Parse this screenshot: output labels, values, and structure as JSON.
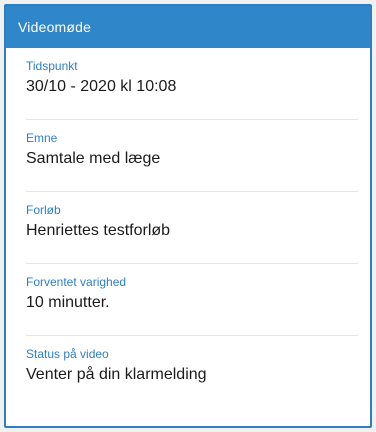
{
  "header": {
    "title": "Videomøde"
  },
  "details": [
    {
      "label": "Tidspunkt",
      "value": "30/10 - 2020 kl 10:08"
    },
    {
      "label": "Emne",
      "value": "Samtale med læge"
    },
    {
      "label": "Forløb",
      "value": "Henriettes testforløb"
    },
    {
      "label": "Forventet varighed",
      "value": "10 minutter."
    },
    {
      "label": "Status på video",
      "value": "Venter på din klarmelding"
    }
  ],
  "colors": {
    "header_bg": "#2f86c9",
    "frame": "#2c7fc3",
    "label_text": "#2d7fc4",
    "value_text": "#1b1b1b"
  }
}
